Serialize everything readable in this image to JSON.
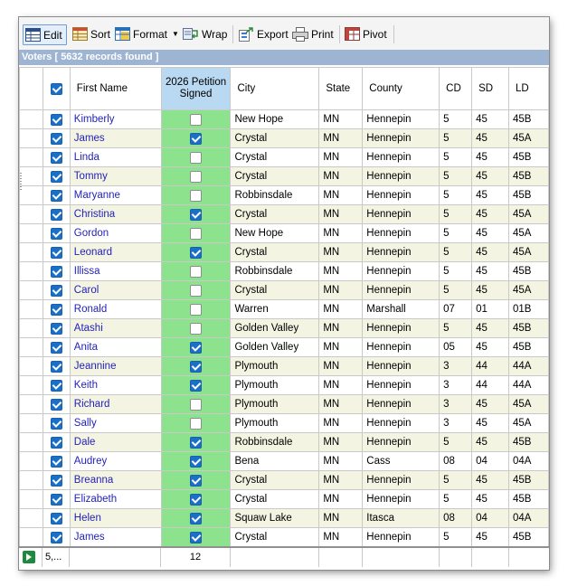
{
  "toolbar": {
    "edit": "Edit",
    "sort": "Sort",
    "format": "Format",
    "wrap": "Wrap",
    "export": "Export",
    "print": "Print",
    "pivot": "Pivot"
  },
  "banner": "Voters [ 5632 records found ]",
  "columns": {
    "first_name": "First Name",
    "petition": "2026 Petition Signed",
    "city": "City",
    "state": "State",
    "county": "County",
    "cd": "CD",
    "sd": "SD",
    "ld": "LD"
  },
  "rows": [
    {
      "selected": true,
      "first_name": "Kimberly",
      "signed": false,
      "city": "New Hope",
      "state": "MN",
      "county": "Hennepin",
      "cd": "5",
      "sd": "45",
      "ld": "45B"
    },
    {
      "selected": true,
      "first_name": "James",
      "signed": true,
      "city": "Crystal",
      "state": "MN",
      "county": "Hennepin",
      "cd": "5",
      "sd": "45",
      "ld": "45A"
    },
    {
      "selected": true,
      "first_name": "Linda",
      "signed": false,
      "city": "Crystal",
      "state": "MN",
      "county": "Hennepin",
      "cd": "5",
      "sd": "45",
      "ld": "45B"
    },
    {
      "selected": true,
      "first_name": "Tommy",
      "signed": false,
      "city": "Crystal",
      "state": "MN",
      "county": "Hennepin",
      "cd": "5",
      "sd": "45",
      "ld": "45B"
    },
    {
      "selected": true,
      "first_name": "Maryanne",
      "signed": false,
      "city": "Robbinsdale",
      "state": "MN",
      "county": "Hennepin",
      "cd": "5",
      "sd": "45",
      "ld": "45B"
    },
    {
      "selected": true,
      "first_name": "Christina",
      "signed": true,
      "city": "Crystal",
      "state": "MN",
      "county": "Hennepin",
      "cd": "5",
      "sd": "45",
      "ld": "45A"
    },
    {
      "selected": true,
      "first_name": "Gordon",
      "signed": false,
      "city": "New Hope",
      "state": "MN",
      "county": "Hennepin",
      "cd": "5",
      "sd": "45",
      "ld": "45A"
    },
    {
      "selected": true,
      "first_name": "Leonard",
      "signed": true,
      "city": "Crystal",
      "state": "MN",
      "county": "Hennepin",
      "cd": "5",
      "sd": "45",
      "ld": "45A"
    },
    {
      "selected": true,
      "first_name": "Illissa",
      "signed": false,
      "city": "Robbinsdale",
      "state": "MN",
      "county": "Hennepin",
      "cd": "5",
      "sd": "45",
      "ld": "45B"
    },
    {
      "selected": true,
      "first_name": "Carol",
      "signed": false,
      "city": "Crystal",
      "state": "MN",
      "county": "Hennepin",
      "cd": "5",
      "sd": "45",
      "ld": "45A"
    },
    {
      "selected": true,
      "first_name": "Ronald",
      "signed": false,
      "city": "Warren",
      "state": "MN",
      "county": "Marshall",
      "cd": "07",
      "sd": "01",
      "ld": "01B"
    },
    {
      "selected": true,
      "first_name": "Atashi",
      "signed": false,
      "city": "Golden Valley",
      "state": "MN",
      "county": "Hennepin",
      "cd": "5",
      "sd": "45",
      "ld": "45B"
    },
    {
      "selected": true,
      "first_name": "Anita",
      "signed": true,
      "city": "Golden Valley",
      "state": "MN",
      "county": "Hennepin",
      "cd": "05",
      "sd": "45",
      "ld": "45B"
    },
    {
      "selected": true,
      "first_name": "Jeannine",
      "signed": true,
      "city": "Plymouth",
      "state": "MN",
      "county": "Hennepin",
      "cd": "3",
      "sd": "44",
      "ld": "44A"
    },
    {
      "selected": true,
      "first_name": "Keith",
      "signed": true,
      "city": "Plymouth",
      "state": "MN",
      "county": "Hennepin",
      "cd": "3",
      "sd": "44",
      "ld": "44A"
    },
    {
      "selected": true,
      "first_name": "Richard",
      "signed": false,
      "city": "Plymouth",
      "state": "MN",
      "county": "Hennepin",
      "cd": "3",
      "sd": "45",
      "ld": "45A"
    },
    {
      "selected": true,
      "first_name": "Sally",
      "signed": false,
      "city": "Plymouth",
      "state": "MN",
      "county": "Hennepin",
      "cd": "3",
      "sd": "45",
      "ld": "45A"
    },
    {
      "selected": true,
      "first_name": "Dale",
      "signed": true,
      "city": "Robbinsdale",
      "state": "MN",
      "county": "Hennepin",
      "cd": "5",
      "sd": "45",
      "ld": "45B"
    },
    {
      "selected": true,
      "first_name": "Audrey",
      "signed": true,
      "city": "Bena",
      "state": "MN",
      "county": "Cass",
      "cd": "08",
      "sd": "04",
      "ld": "04A"
    },
    {
      "selected": true,
      "first_name": "Breanna",
      "signed": true,
      "city": "Crystal",
      "state": "MN",
      "county": "Hennepin",
      "cd": "5",
      "sd": "45",
      "ld": "45B"
    },
    {
      "selected": true,
      "first_name": "Elizabeth",
      "signed": true,
      "city": "Crystal",
      "state": "MN",
      "county": "Hennepin",
      "cd": "5",
      "sd": "45",
      "ld": "45B"
    },
    {
      "selected": true,
      "first_name": "Helen",
      "signed": true,
      "city": "Squaw Lake",
      "state": "MN",
      "county": "Itasca",
      "cd": "08",
      "sd": "04",
      "ld": "04A"
    },
    {
      "selected": true,
      "first_name": "James",
      "signed": true,
      "city": "Crystal",
      "state": "MN",
      "county": "Hennepin",
      "cd": "5",
      "sd": "45",
      "ld": "45B"
    }
  ],
  "footer": {
    "count": "5,...",
    "signed_total": "12"
  },
  "colors": {
    "banner": "#9db5d3",
    "petition_header": "#b9d9f2",
    "petition_cells": "#8de38d",
    "name_text": "#2222bb",
    "alt_row": "#f4f4e2",
    "checkbox": "#1a6fc9"
  }
}
